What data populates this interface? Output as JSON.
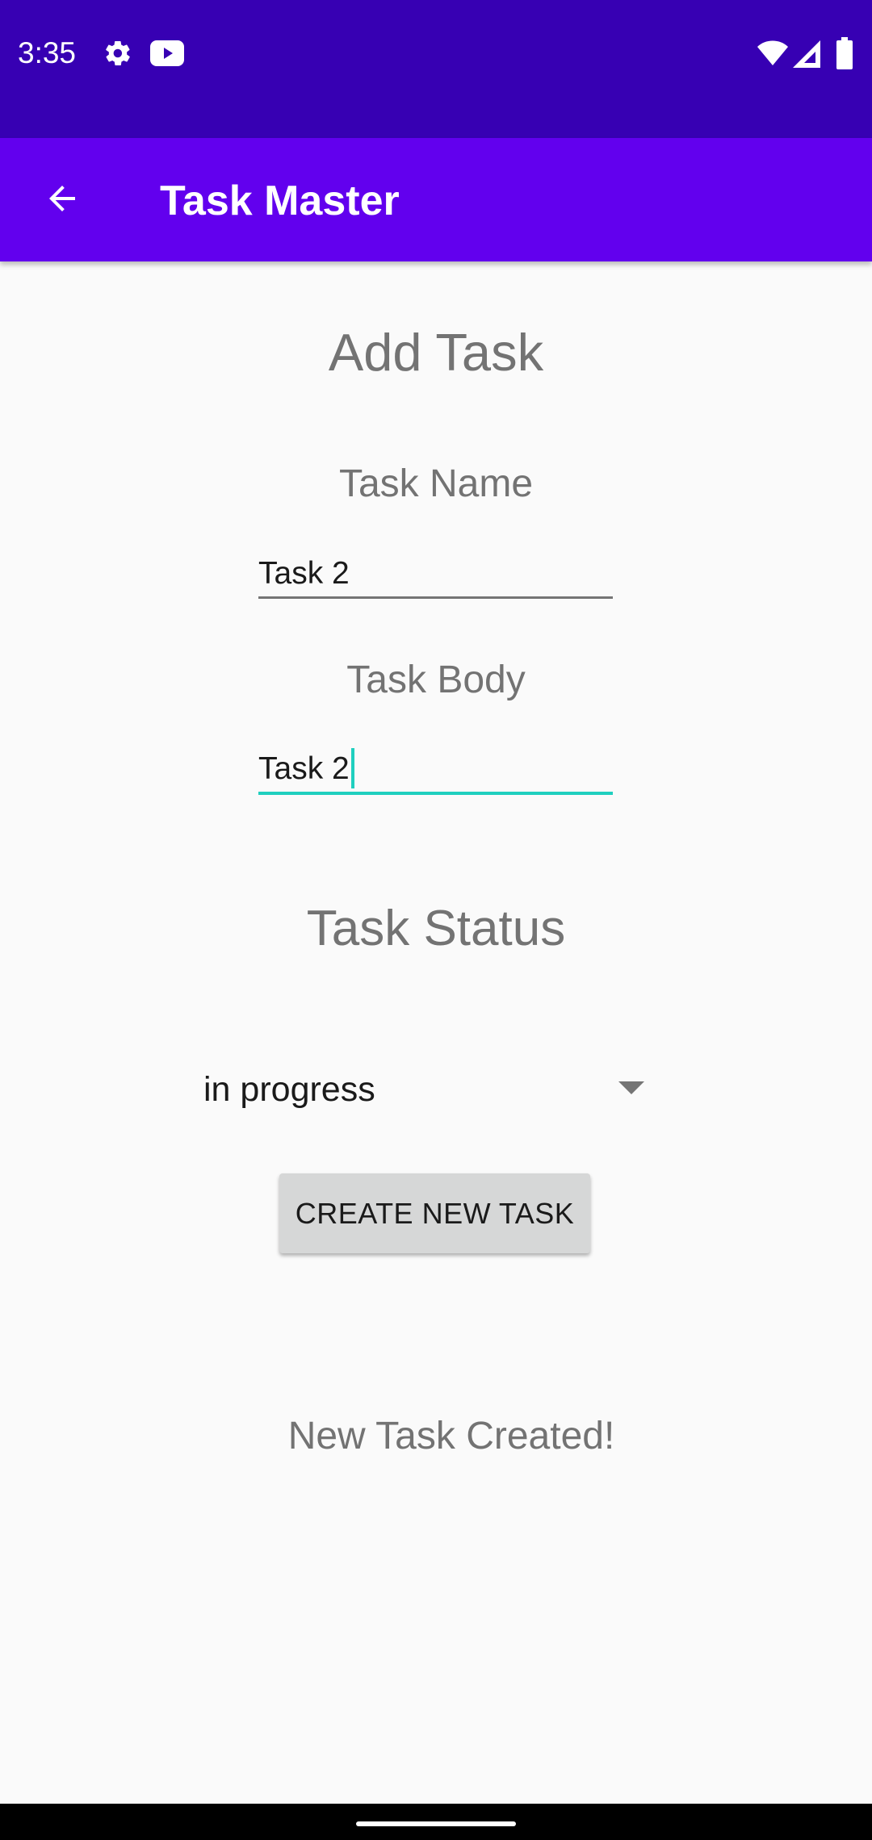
{
  "status_bar": {
    "time": "3:35",
    "icons": [
      "settings-icon",
      "youtube-icon",
      "wifi-icon",
      "signal-icon",
      "battery-icon"
    ]
  },
  "app_bar": {
    "title": "Task Master",
    "back_icon": "arrow-back-icon"
  },
  "form": {
    "heading": "Add Task",
    "task_name_label": "Task Name",
    "task_name_value": "Task 2",
    "task_body_label": "Task Body",
    "task_body_value": "Task 2",
    "task_status_label": "Task Status",
    "task_status_value": "in progress",
    "create_button_label": "CREATE NEW TASK",
    "result_message": "New Task Created!"
  },
  "colors": {
    "status_bar": "#3700b3",
    "app_bar": "#6200ee",
    "focus_accent": "#1fcfbf",
    "button": "#d6d7d7"
  }
}
